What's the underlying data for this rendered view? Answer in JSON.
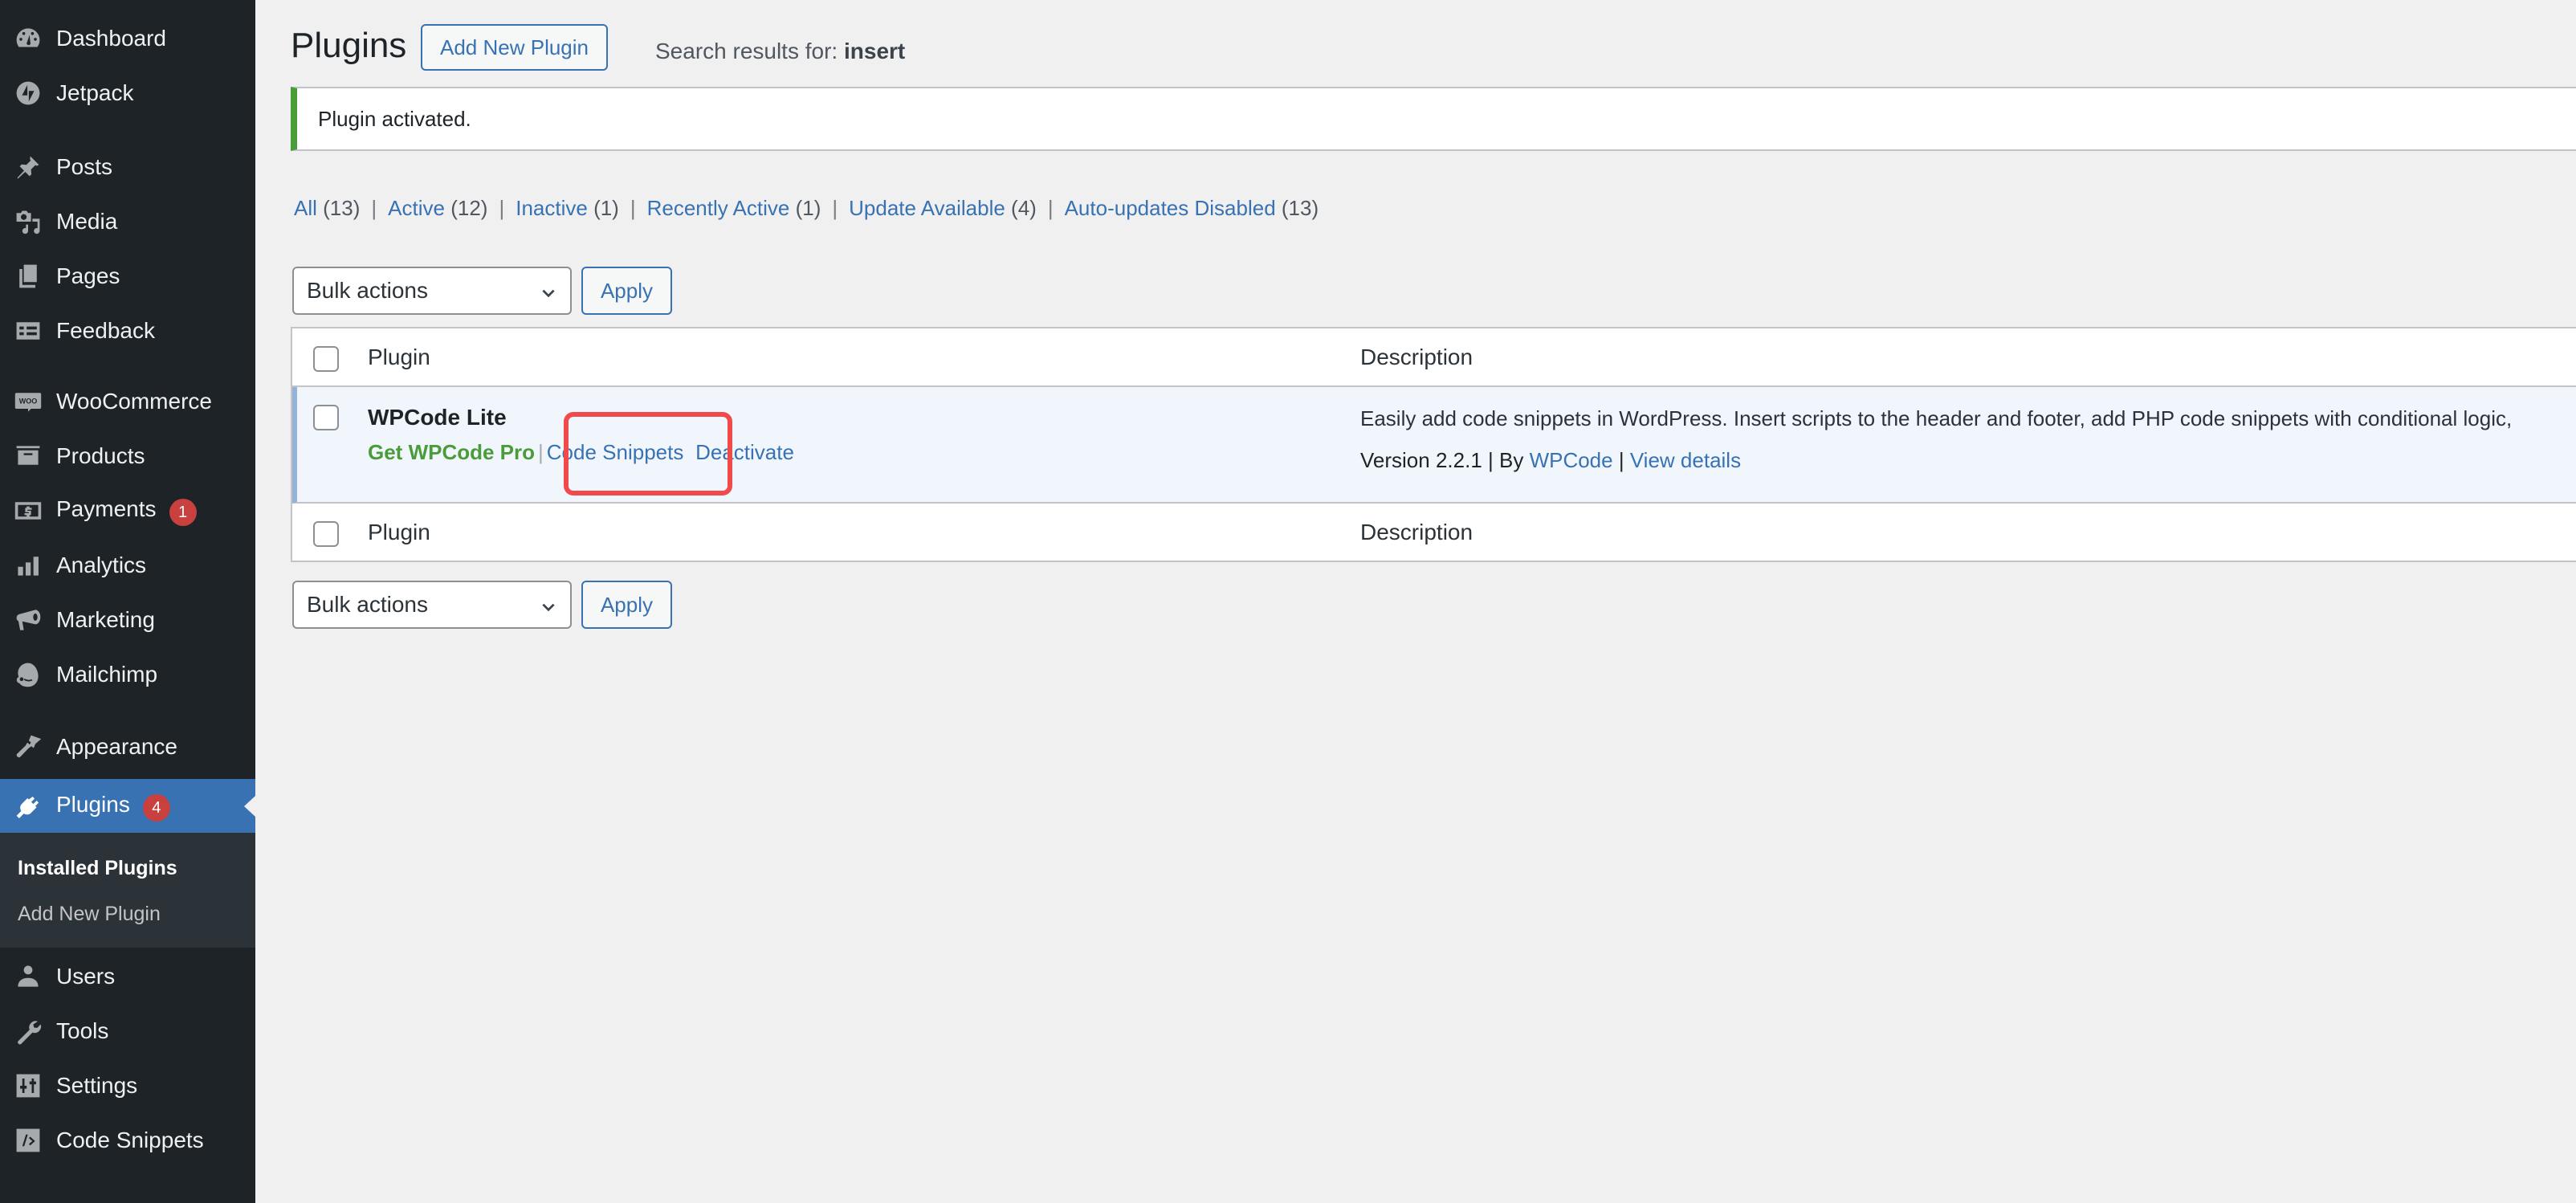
{
  "sidebar": {
    "items": [
      {
        "label": "Dashboard",
        "icon": "dashboard-icon"
      },
      {
        "label": "Jetpack",
        "icon": "jetpack-icon"
      },
      {
        "label": "Posts",
        "icon": "pin-icon"
      },
      {
        "label": "Media",
        "icon": "media-icon"
      },
      {
        "label": "Pages",
        "icon": "pages-icon"
      },
      {
        "label": "Feedback",
        "icon": "feedback-icon"
      },
      {
        "label": "WooCommerce",
        "icon": "woo-icon"
      },
      {
        "label": "Products",
        "icon": "archive-icon"
      },
      {
        "label": "Payments",
        "icon": "dollar-icon",
        "badge": "1"
      },
      {
        "label": "Analytics",
        "icon": "bar-chart-icon"
      },
      {
        "label": "Marketing",
        "icon": "megaphone-icon"
      },
      {
        "label": "Mailchimp",
        "icon": "mailchimp-icon"
      },
      {
        "label": "Appearance",
        "icon": "paintbrush-icon"
      },
      {
        "label": "Plugins",
        "icon": "plugin-icon",
        "badge": "4",
        "active": true
      },
      {
        "label": "Users",
        "icon": "user-icon"
      },
      {
        "label": "Tools",
        "icon": "wrench-icon"
      },
      {
        "label": "Settings",
        "icon": "settings-icon"
      },
      {
        "label": "Code Snippets",
        "icon": "code-icon"
      }
    ],
    "submenu": [
      {
        "label": "Installed Plugins",
        "current": true
      },
      {
        "label": "Add New Plugin"
      }
    ]
  },
  "header": {
    "title": "Plugins",
    "add_new_label": "Add New Plugin",
    "search_prefix": "Search results for: ",
    "search_term": "insert"
  },
  "notice": {
    "text": "Plugin activated."
  },
  "filters": [
    {
      "label": "All",
      "count": "(13)"
    },
    {
      "label": "Active",
      "count": "(12)"
    },
    {
      "label": "Inactive",
      "count": "(1)"
    },
    {
      "label": "Recently Active",
      "count": "(1)"
    },
    {
      "label": "Update Available",
      "count": "(4)"
    },
    {
      "label": "Auto-updates Disabled",
      "count": "(13)"
    }
  ],
  "bulk_actions": {
    "selected": "Bulk actions",
    "apply_label": "Apply"
  },
  "table": {
    "columns": [
      "Plugin",
      "Description"
    ],
    "rows": [
      {
        "name": "WPCode Lite",
        "actions": {
          "pro": "Get WPCode Pro",
          "snippets": "Code Snippets",
          "deactivate": "Deactivate"
        },
        "description": "Easily add code snippets in WordPress. Insert scripts to the header and footer, add PHP code snippets with conditional logic,",
        "version": "Version 2.2.1",
        "by": "By",
        "author": "WPCode",
        "view_details": "View details"
      }
    ]
  },
  "colors": {
    "accent": "#3872b2",
    "sidebar_bg": "#1d2327",
    "notice_success": "#4a9c3a",
    "badge": "#c9413f",
    "highlight": "#f04a4a"
  }
}
